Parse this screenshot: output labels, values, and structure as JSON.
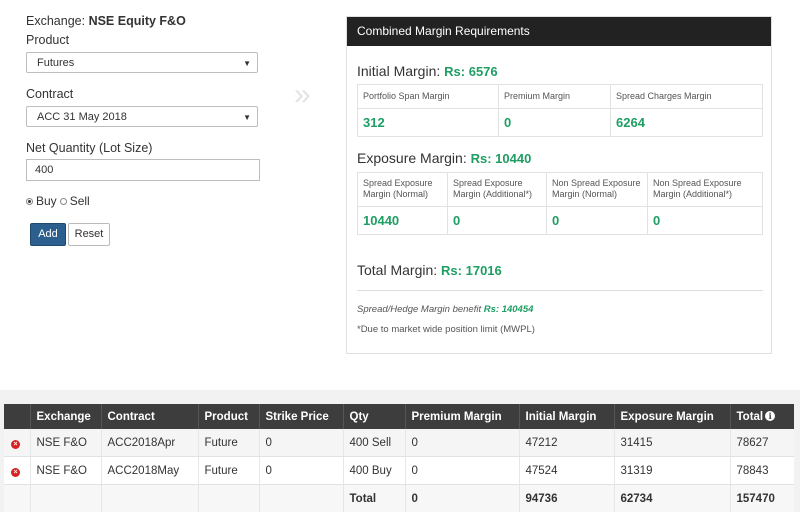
{
  "form": {
    "exchange_label": "Exchange:",
    "exchange_value": "NSE Equity F&O",
    "product_label": "Product",
    "product_value": "Futures",
    "contract_label": "Contract",
    "contract_value": "ACC 31 May 2018",
    "qty_label": "Net Quantity (Lot Size)",
    "qty_value": "400",
    "buy_label": "Buy",
    "sell_label": "Sell",
    "add_label": "Add",
    "reset_label": "Reset"
  },
  "panel": {
    "title": "Combined Margin Requirements",
    "initial": {
      "label": "Initial Margin:",
      "amount": "Rs: 6576",
      "headers": [
        "Portfolio Span Margin",
        "Premium Margin",
        "Spread Charges Margin"
      ],
      "values": [
        "312",
        "0",
        "6264"
      ]
    },
    "exposure": {
      "label": "Exposure Margin:",
      "amount": "Rs: 10440",
      "headers": [
        [
          "Spread Exposure",
          "Margin (Normal)"
        ],
        [
          "Spread Exposure",
          "Margin (Additional*)"
        ],
        [
          "Non Spread Exposure",
          "Margin (Normal)"
        ],
        [
          "Non Spread Exposure",
          "Margin (Additional*)"
        ]
      ],
      "values": [
        "10440",
        "0",
        "0",
        "0"
      ]
    },
    "total": {
      "label": "Total Margin:",
      "amount": "Rs: 17016"
    },
    "benefit": {
      "label": "Spread/Hedge Margin benefit",
      "amount": "Rs: 140454"
    },
    "note": "*Due to market wide position limit (MWPL)"
  },
  "table": {
    "columns": [
      "",
      "Exchange",
      "Contract",
      "Product",
      "Strike Price",
      "Qty",
      "Premium Margin",
      "Initial Margin",
      "Exposure Margin",
      "Total"
    ],
    "rows": [
      [
        "NSE F&O",
        "ACC2018Apr",
        "Future",
        "0",
        "400 Sell",
        "0",
        "47212",
        "31415",
        "78627"
      ],
      [
        "NSE F&O",
        "ACC2018May",
        "Future",
        "0",
        "400 Buy",
        "0",
        "47524",
        "31319",
        "78843"
      ]
    ],
    "footer": [
      "",
      "",
      "",
      "",
      "",
      "Total",
      "0",
      "94736",
      "62734",
      "157470"
    ]
  }
}
